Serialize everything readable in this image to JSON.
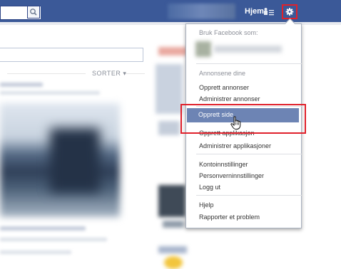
{
  "colors": {
    "fb_blue": "#3b5998",
    "highlight": "#6d84b4",
    "annotation_red": "#e0212b"
  },
  "topbar": {
    "search_icon": "magnifier-icon",
    "home_label": "Hjem",
    "friends_icon": "friend-requests-icon",
    "settings_icon": "gear-icon"
  },
  "feed": {
    "sort_label": "SORTER ▾"
  },
  "menu": {
    "use_as_label": "Bruk Facebook som:",
    "ads_header": "Annonsene dine",
    "items": [
      "Opprett annonser",
      "Administrer annonser",
      "Opprett side",
      "Opprett applikasjon",
      "Administrer applikasjoner",
      "Kontoinnstillinger",
      "Personverninnstillinger",
      "Logg ut",
      "Hjelp",
      "Rapporter et problem"
    ]
  }
}
